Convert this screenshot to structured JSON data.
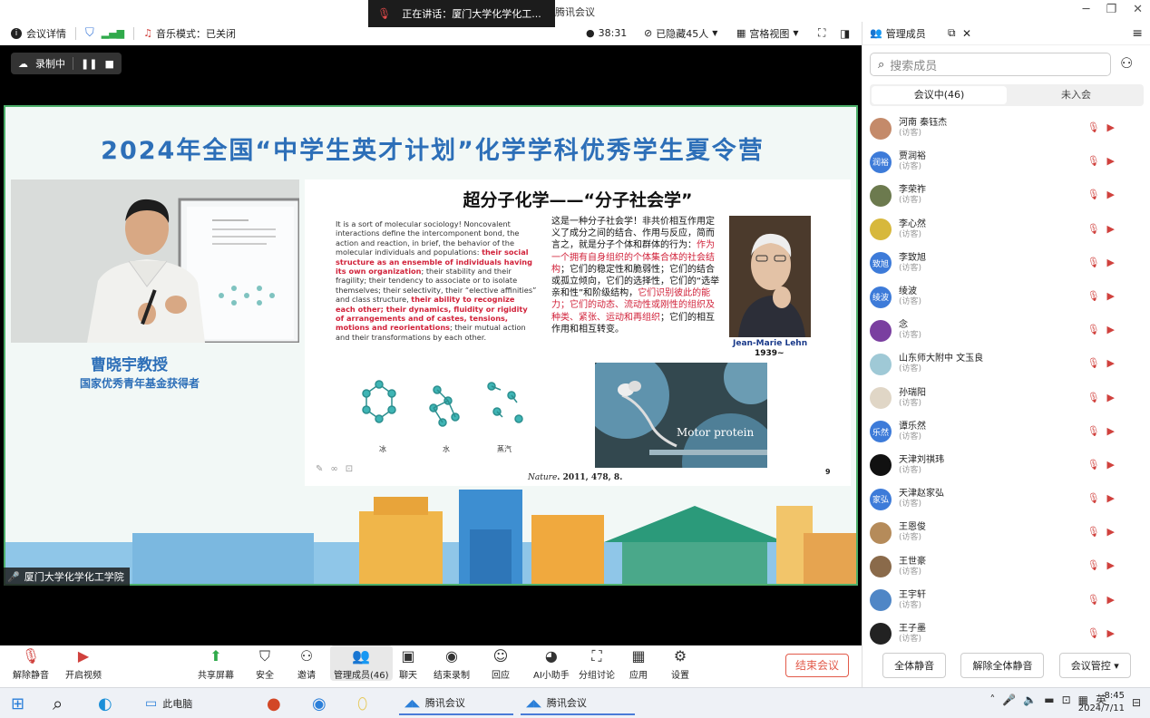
{
  "window": {
    "title": "腾讯会议",
    "speaking_label": "正在讲话：厦门大学化学化工...",
    "controls": [
      "─",
      "❐",
      "✕"
    ]
  },
  "toolbar": {
    "meeting_info": "会议详情",
    "music_mode": "音乐模式：已关闭",
    "timer": "38:31",
    "hidden": "已隐藏45人",
    "grid_view": "宫格视图"
  },
  "panel": {
    "title": "管理成员",
    "search_placeholder": "搜索成员",
    "tab_in": "会议中(46)",
    "tab_out": "未入会",
    "buttons": {
      "mute_all": "全体静音",
      "unmute_all": "解除全体静音",
      "meeting_ctrl": "会议管控 ▾"
    },
    "members": [
      {
        "name": "河南 秦钰杰",
        "role": "(访客)",
        "avatar_text": "",
        "color": "#c48a6a"
      },
      {
        "name": "贾润裕",
        "role": "(访客)",
        "avatar_text": "润裕",
        "color": "#3d7bd9"
      },
      {
        "name": "李荣祚",
        "role": "(访客)",
        "avatar_text": "",
        "color": "#6c7a4e"
      },
      {
        "name": "李心然",
        "role": "(访客)",
        "avatar_text": "",
        "color": "#d7b83c"
      },
      {
        "name": "李致旭",
        "role": "(访客)",
        "avatar_text": "致旭",
        "color": "#3d7bd9"
      },
      {
        "name": "绫波",
        "role": "(访客)",
        "avatar_text": "绫波",
        "color": "#3d7bd9"
      },
      {
        "name": "念",
        "role": "(访客)",
        "avatar_text": "",
        "color": "#7a3fa0"
      },
      {
        "name": "山东师大附中 文玉良",
        "role": "(访客)",
        "avatar_text": "",
        "color": "#9fc9d6"
      },
      {
        "name": "孙瑞阳",
        "role": "(访客)",
        "avatar_text": "",
        "color": "#e0d6c6"
      },
      {
        "name": "谭乐然",
        "role": "(访客)",
        "avatar_text": "乐然",
        "color": "#3d7bd9"
      },
      {
        "name": "天津刘祺玮",
        "role": "(访客)",
        "avatar_text": "",
        "color": "#111111"
      },
      {
        "name": "天津赵家弘",
        "role": "(访客)",
        "avatar_text": "家弘",
        "color": "#3d7bd9"
      },
      {
        "name": "王恩俊",
        "role": "(访客)",
        "avatar_text": "",
        "color": "#b58b5a"
      },
      {
        "name": "王世豪",
        "role": "(访客)",
        "avatar_text": "",
        "color": "#8a6a4a"
      },
      {
        "name": "王宇轩",
        "role": "(访客)",
        "avatar_text": "",
        "color": "#4f86c6"
      },
      {
        "name": "王子墨",
        "role": "(访客)",
        "avatar_text": "",
        "color": "#222222"
      }
    ]
  },
  "video": {
    "recording": "录制中",
    "camp_title": "2024年全国“中学生英才计划”化学学科优秀学生夏令营",
    "speaker_name": "曹晓宇教授",
    "speaker_title": "国家优秀青年基金获得者",
    "speaker_tag": "厦门大学化学化工学院",
    "slide": {
      "title": "超分子化学——“分子社会学”",
      "en_1": "It is a sort of molecular sociology! Noncovalent interactions define the intercomponent bond, the action and reaction, in brief, the behavior of the molecular individuals and populations: ",
      "en_hl_1": "their social structure as an ensemble of individuals having its own organization",
      "en_2": "; their stability and their fragility; their tendency to associate or to isolate themselves; their selectivity, their “elective affinities” and class structure, ",
      "en_hl_2": "their ability to recognize each other; their dynamics, fluidity or rigidity of arrangements and of castes, tensions, motions and reorientations",
      "en_3": "; their mutual action and their transformations by each other.",
      "zh_1": "这是一种分子社会学！非共价相互作用定义了成分之间的结合、作用与反应，简而言之，就是分子个体和群体的行为：",
      "zh_hl_1": "作为一个拥有自身组织的个体集合体的社会结构",
      "zh_2": "；它们的稳定性和脆弱性；它们的结合或孤立倾向，它们的选择性，它们的“选举亲和性”和阶级结构，",
      "zh_hl_2": "它们识别彼此的能力；它们的动态、流动性或刚性的组织及种类、紧张、运动和再组织",
      "zh_3": "；它们的相互作用和相互转变。",
      "portrait_name": "Jean-Marie Lehn",
      "portrait_year": "1939~",
      "motor_label": "Motor protein",
      "mol_labels": [
        "冰",
        "水",
        "蒸汽"
      ],
      "ref_journal": "Nature",
      "ref_rest": ". 2011, 478, 8.",
      "page": "9"
    }
  },
  "controls": {
    "unmute": "解除静音",
    "video": "开启视频",
    "share": "共享屏幕",
    "security": "安全",
    "invite": "邀请",
    "members": "管理成员(46)",
    "chat": "聊天",
    "end_rec": "结束录制",
    "react": "回应",
    "ai": "AI小助手",
    "breakout": "分组讨论",
    "apps": "应用",
    "settings": "设置",
    "end_meeting": "结束会议"
  },
  "taskbar": {
    "pc": "此电脑",
    "app1": "腾讯会议",
    "app2": "腾讯会议",
    "ime": "英",
    "time": "8:45",
    "date": "2024/7/11"
  },
  "colors": {
    "accent": "#2d6fb8",
    "danger": "#e25a4a",
    "highlight": "#d1223a"
  }
}
